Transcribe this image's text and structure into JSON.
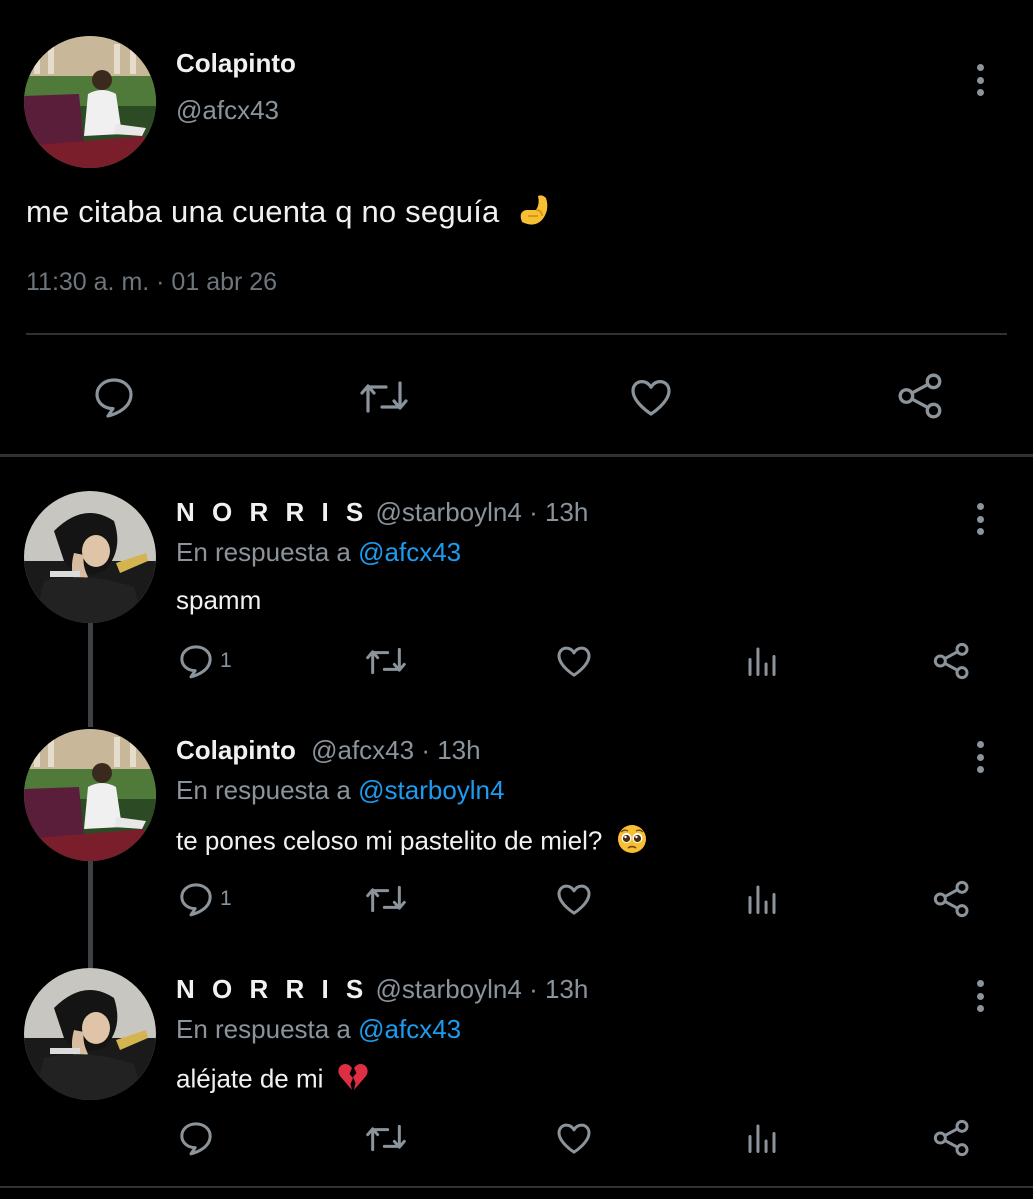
{
  "main_tweet": {
    "name": "Colapinto",
    "handle": "@afcx43",
    "text": "me citaba una cuenta q no seguía",
    "emoji": "pinching-hand",
    "meta": "11:30 a. m. · 01 abr 26"
  },
  "replies": [
    {
      "name": "N O R R I S",
      "handle": "@starboyln4",
      "time": "· 13h",
      "in_reply_prefix": "En respuesta a",
      "in_reply_to": "@afcx43",
      "text": "spamm",
      "reply_count": "1",
      "emoji": ""
    },
    {
      "name": "Colapinto",
      "handle": "@afcx43",
      "time": "· 13h",
      "in_reply_prefix": "En respuesta a",
      "in_reply_to": "@starboyln4",
      "text": "te pones celoso mi pastelito de miel?",
      "reply_count": "1",
      "emoji": "pleading-face"
    },
    {
      "name": "N O R R I S",
      "handle": "@starboyln4",
      "time": "· 13h",
      "in_reply_prefix": "En respuesta a",
      "in_reply_to": "@afcx43",
      "text": "aléjate de mi",
      "reply_count": "",
      "emoji": "broken-heart"
    }
  ],
  "colors": {
    "background": "#000000",
    "text": "#f1f1f1",
    "secondary": "#8b939b",
    "mention": "#1d9bf0",
    "divider": "#2f3336"
  }
}
